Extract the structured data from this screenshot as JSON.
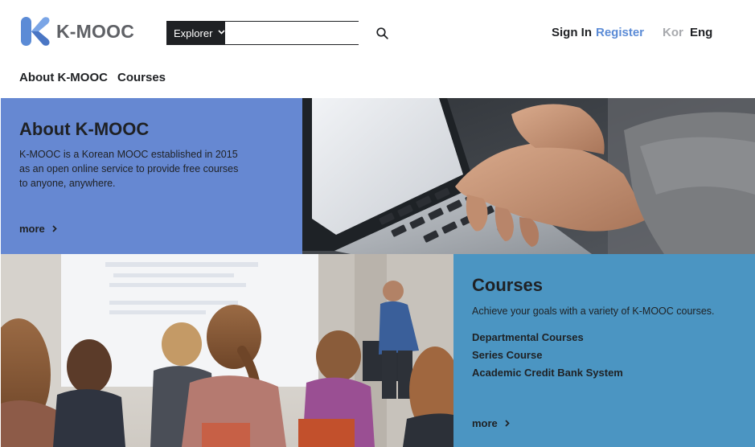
{
  "brand": {
    "name": "K-MOOC"
  },
  "search": {
    "category_label": "Explorer",
    "placeholder": "",
    "value": ""
  },
  "auth": {
    "sign_in": "Sign In",
    "register": "Register"
  },
  "languages": {
    "kor": "Kor",
    "eng": "Eng",
    "active": "Eng"
  },
  "nav": {
    "items": [
      {
        "label": "About K-MOOC"
      },
      {
        "label": "Courses"
      }
    ]
  },
  "about": {
    "title": "About K-MOOC",
    "description_lines": [
      "K-MOOC is a Korean MOOC established in 2015",
      "as an open online service to provide free courses",
      "to anyone, anywhere."
    ],
    "more": "more"
  },
  "courses": {
    "title": "Courses",
    "description": "Achieve your goals with a variety of K-MOOC courses.",
    "links": [
      {
        "label": "Departmental Courses"
      },
      {
        "label": "Series Course"
      },
      {
        "label": "Academic Credit Bank System"
      }
    ],
    "more": "more"
  },
  "colors": {
    "about_panel": "#6688d2",
    "courses_panel": "#4b95c2",
    "register_link": "#5b8bd6",
    "logo_blue": "#5b8bd6",
    "inactive_language": "#a7a9ad",
    "text": "#1f2124"
  },
  "icons": {
    "logo": "k-logo-icon",
    "dropdown": "chevron-down-icon",
    "search": "search-icon",
    "more": "chevron-right-icon"
  },
  "images": {
    "hero_top": "hands typing on laptop keyboard",
    "hero_bottom": "students in classroom watching presenter"
  }
}
